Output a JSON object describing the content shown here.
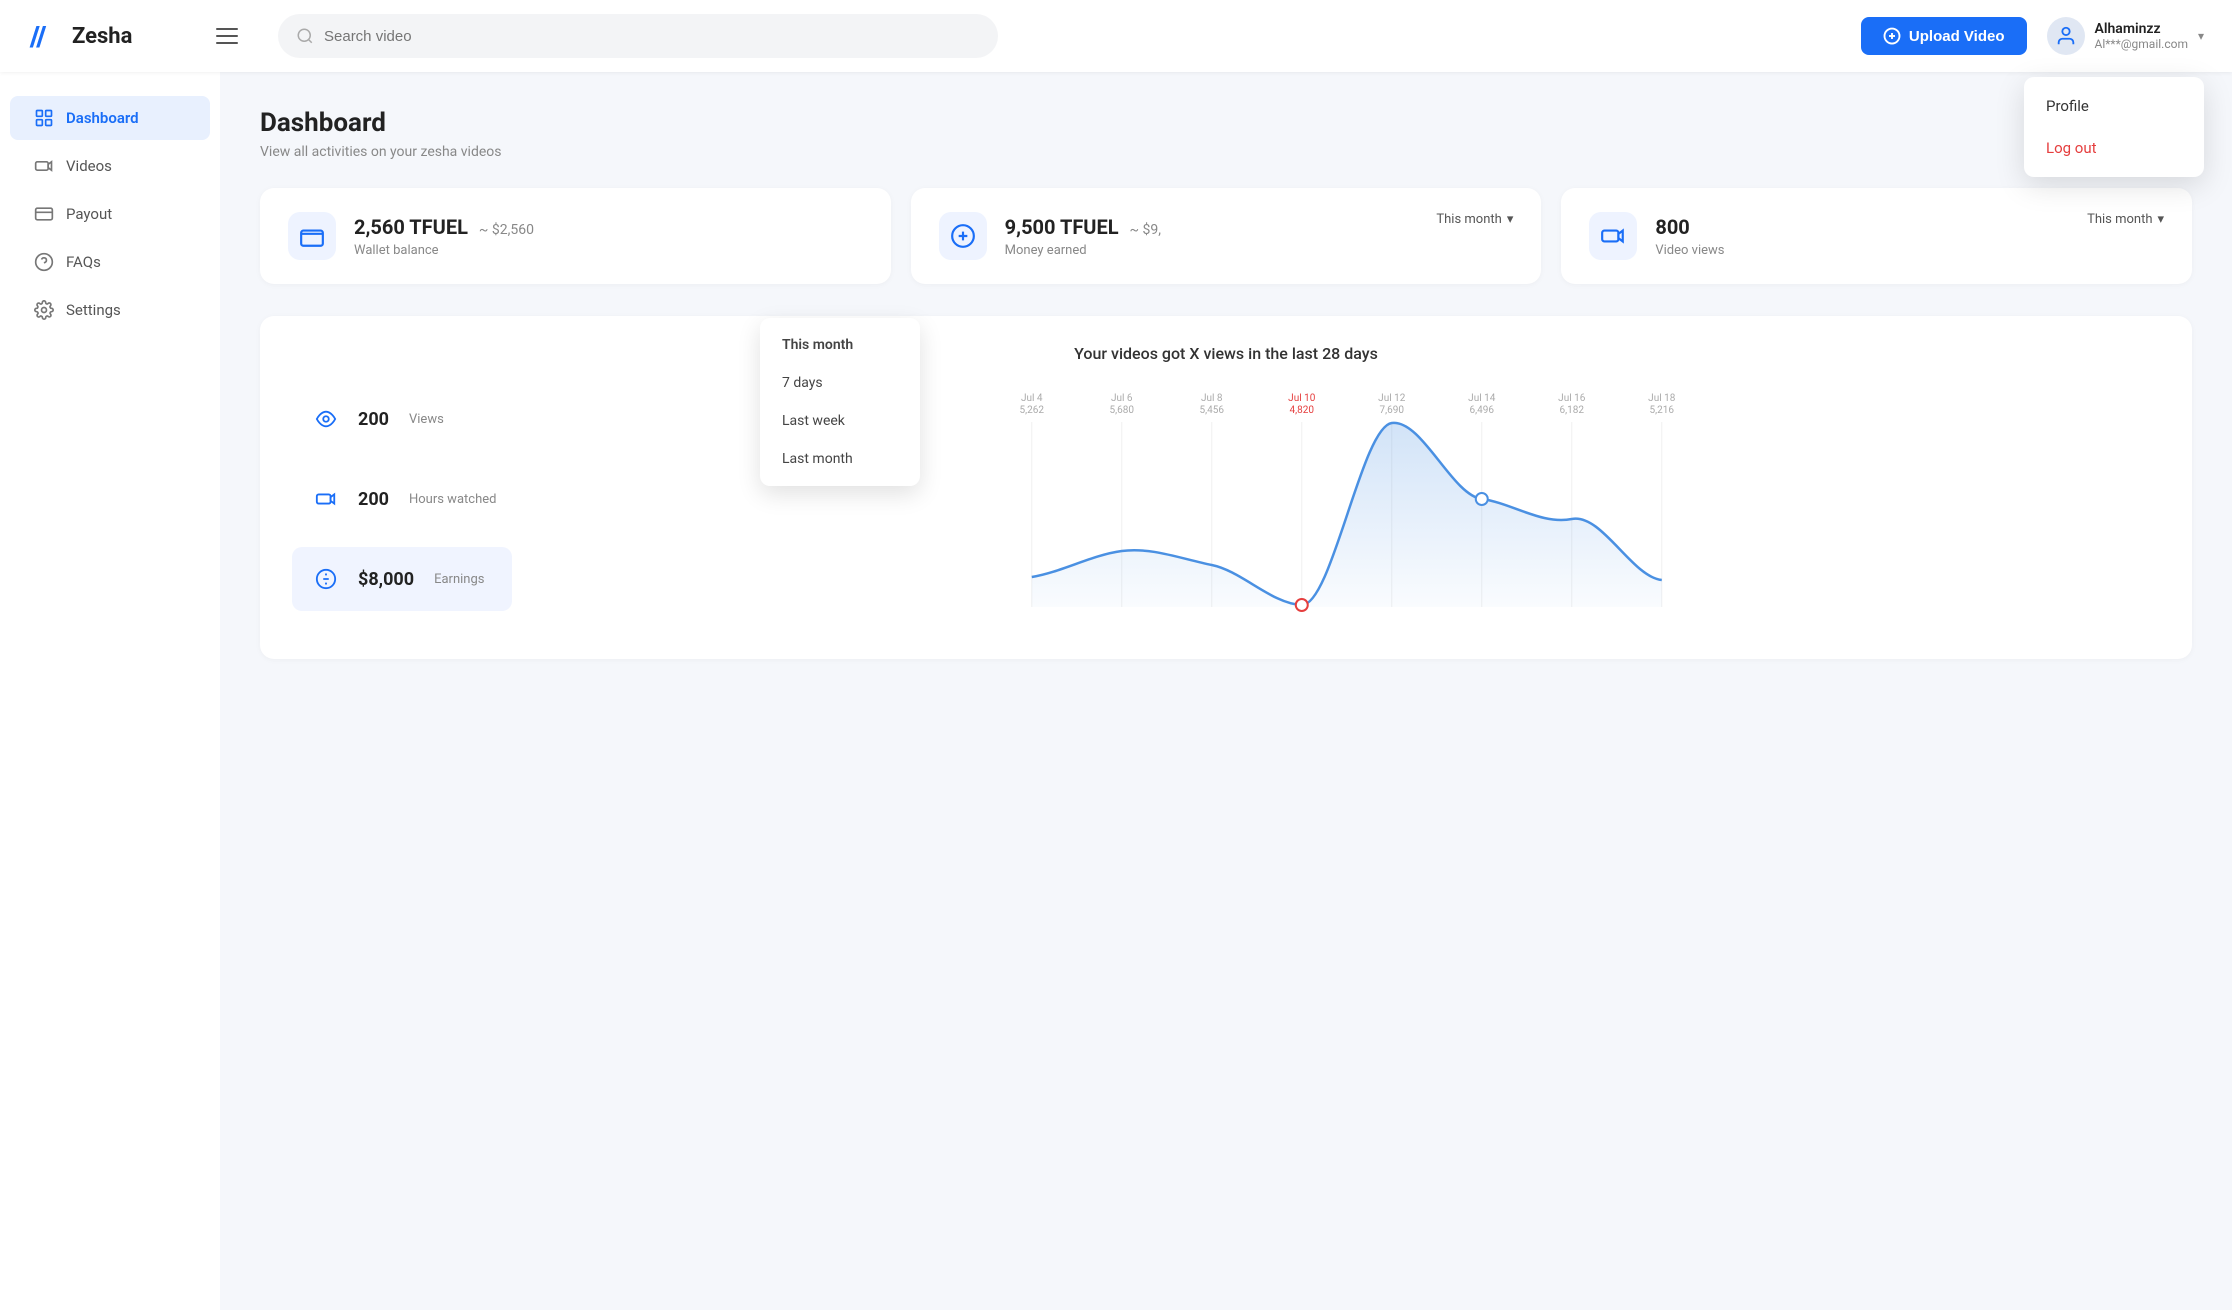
{
  "app": {
    "name": "Zesha"
  },
  "topnav": {
    "search_placeholder": "Search video",
    "upload_label": "Upload Video",
    "user": {
      "name": "Alhaminzz",
      "email": "Al***@gmail.com"
    }
  },
  "user_menu": {
    "profile_label": "Profile",
    "logout_label": "Log out"
  },
  "sidebar": {
    "items": [
      {
        "id": "dashboard",
        "label": "Dashboard",
        "active": true
      },
      {
        "id": "videos",
        "label": "Videos",
        "active": false
      },
      {
        "id": "payout",
        "label": "Payout",
        "active": false
      },
      {
        "id": "faqs",
        "label": "FAQs",
        "active": false
      },
      {
        "id": "settings",
        "label": "Settings",
        "active": false
      }
    ]
  },
  "page": {
    "title": "Dashboard",
    "subtitle": "View all activities on your zesha videos"
  },
  "stat_cards": [
    {
      "id": "wallet",
      "value": "2,560 TFUEL",
      "sub": "~ $2,560",
      "label": "Wallet balance",
      "filter": null
    },
    {
      "id": "money",
      "value": "9,500 TFUEL",
      "sub": "~ $9,",
      "label": "Money earned",
      "filter": "This month"
    },
    {
      "id": "views",
      "value": "800",
      "label": "Video views",
      "filter": "This month"
    }
  ],
  "period_dropdown": {
    "options": [
      {
        "label": "This month",
        "selected": true
      },
      {
        "label": "7 days",
        "selected": false
      },
      {
        "label": "Last week",
        "selected": false
      },
      {
        "label": "Last month",
        "selected": false
      }
    ]
  },
  "chart": {
    "title": "Your videos got X views in the last 28 days",
    "stats": [
      {
        "id": "views",
        "value": "200",
        "label": "Views"
      },
      {
        "id": "hours",
        "value": "200",
        "label": "Hours watched"
      },
      {
        "id": "earnings",
        "value": "$8,000",
        "label": "Earnings",
        "highlighted": true
      }
    ],
    "x_labels": [
      {
        "date": "Jul 4",
        "value": "5,262"
      },
      {
        "date": "Jul 6",
        "value": "5,680"
      },
      {
        "date": "Jul 8",
        "value": "5,456"
      },
      {
        "date": "Jul 10",
        "value": "4,820",
        "highlight": "red"
      },
      {
        "date": "Jul 12",
        "value": "7,690"
      },
      {
        "date": "Jul 14",
        "value": "6,496",
        "highlight": "blue"
      },
      {
        "date": "Jul 16",
        "value": "6,182"
      },
      {
        "date": "Jul 18",
        "value": "5,216"
      }
    ]
  },
  "colors": {
    "primary": "#1a6ef7",
    "accent_red": "#e53e3e",
    "chart_line": "#4a90e2",
    "chart_fill": "rgba(74,144,226,0.15)"
  }
}
